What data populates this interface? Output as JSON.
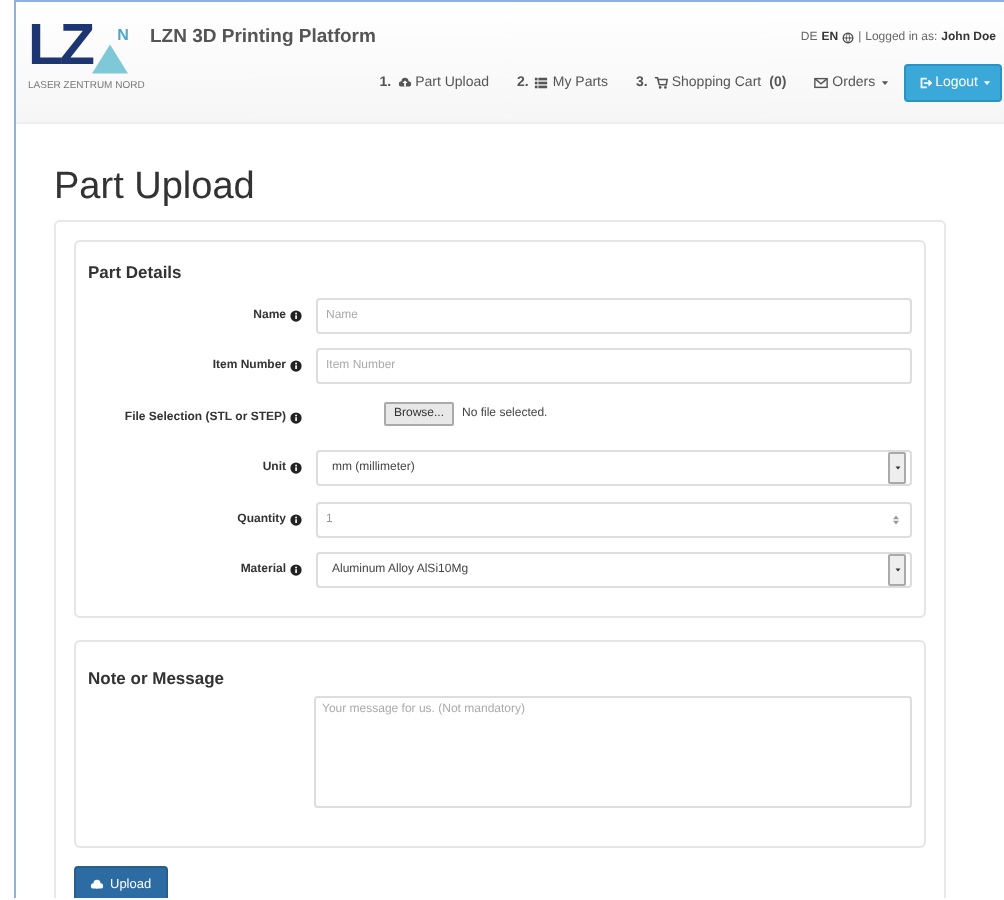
{
  "header": {
    "logo": {
      "letters": "LZ",
      "superscript": "N",
      "tagline": "LASER ZENTRUM NORD"
    },
    "title": "LZN 3D Printing Platform",
    "languages": [
      {
        "label": "DE",
        "selected": false
      },
      {
        "label": "EN",
        "selected": true
      }
    ],
    "separator": "|",
    "login_label": "Logged in as:",
    "user": "John Doe"
  },
  "nav": [
    {
      "kind": "link",
      "number": "1.",
      "label": "Part Upload"
    },
    {
      "kind": "link",
      "number": "2.",
      "label": "My Parts"
    },
    {
      "kind": "link",
      "number": "3.",
      "label": "Shopping Cart",
      "count": "(0)"
    },
    {
      "kind": "dropdown",
      "label": "Orders"
    },
    {
      "kind": "primary",
      "label": "Logout"
    }
  ],
  "page_title": "Part Upload",
  "details": {
    "heading": "Part Details",
    "fields": [
      {
        "kind": "text",
        "label": "Name",
        "placeholder": "Name"
      },
      {
        "kind": "text",
        "label": "Item Number",
        "placeholder": "Item Number"
      },
      {
        "kind": "file",
        "label": "File Selection (STL or STEP)",
        "button": "Browse...",
        "status": "No file selected."
      },
      {
        "kind": "select",
        "label": "Unit",
        "value": "mm (millimeter)"
      },
      {
        "kind": "number",
        "label": "Quantity",
        "placeholder": "1"
      },
      {
        "kind": "select",
        "label": "Material",
        "value": "Aluminum Alloy AlSi10Mg"
      }
    ]
  },
  "note": {
    "heading": "Note or Message",
    "placeholder": "Your message for us. (Not mandatory)"
  },
  "submit": {
    "label": "Upload"
  }
}
